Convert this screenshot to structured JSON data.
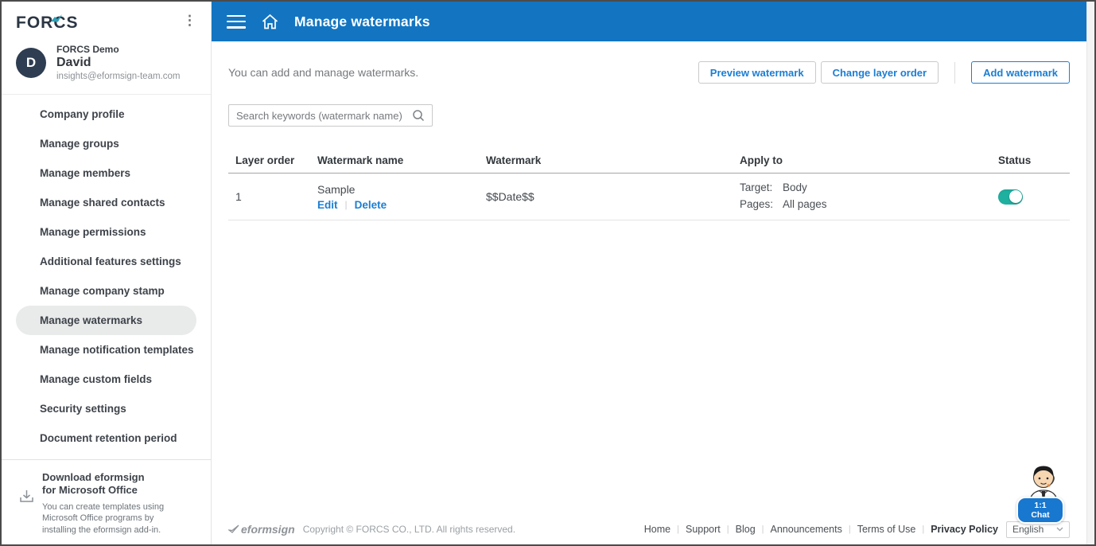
{
  "sidebar": {
    "logo_text": "FORCS",
    "profile": {
      "avatar_initial": "D",
      "company": "FORCS Demo",
      "name": "David",
      "email": "insights@eformsign-team.com"
    },
    "items": [
      {
        "label": "Company profile",
        "active": false
      },
      {
        "label": "Manage groups",
        "active": false
      },
      {
        "label": "Manage members",
        "active": false
      },
      {
        "label": "Manage shared contacts",
        "active": false
      },
      {
        "label": "Manage permissions",
        "active": false
      },
      {
        "label": "Additional features settings",
        "active": false
      },
      {
        "label": "Manage company stamp",
        "active": false
      },
      {
        "label": "Manage watermarks",
        "active": true
      },
      {
        "label": "Manage notification templates",
        "active": false
      },
      {
        "label": "Manage custom fields",
        "active": false
      },
      {
        "label": "Security settings",
        "active": false
      },
      {
        "label": "Document retention period",
        "active": false
      }
    ],
    "download": {
      "title": "Download eformsign for Microsoft Office",
      "description": "You can create templates using Microsoft Office programs by installing the eformsign add-in."
    }
  },
  "topbar": {
    "title": "Manage watermarks"
  },
  "main": {
    "description": "You can add and manage watermarks.",
    "buttons": {
      "preview": "Preview watermark",
      "change_order": "Change layer order",
      "add": "Add watermark"
    },
    "search": {
      "placeholder": "Search keywords (watermark name)"
    },
    "table": {
      "headers": [
        "Layer order",
        "Watermark name",
        "Watermark",
        "Apply to",
        "Status"
      ],
      "rows": [
        {
          "layer_order": "1",
          "name": "Sample",
          "edit_label": "Edit",
          "delete_label": "Delete",
          "watermark": "$$Date$$",
          "apply_to": {
            "target_label": "Target:",
            "target_value": "Body",
            "pages_label": "Pages:",
            "pages_value": "All pages"
          },
          "status_on": true
        }
      ]
    }
  },
  "footer": {
    "logo": "eformsign",
    "copyright": "Copyright © FORCS CO., LTD. All rights reserved.",
    "links": [
      "Home",
      "Support",
      "Blog",
      "Announcements",
      "Terms of Use",
      "Privacy Policy"
    ],
    "language": "English"
  },
  "chat": {
    "label": "1:1 Chat"
  },
  "colors": {
    "topbar_blue": "#1375c1",
    "accent_blue": "#1b7ed3",
    "toggle_teal": "#1fb0a0",
    "logo_teal": "#2f9fb5"
  }
}
